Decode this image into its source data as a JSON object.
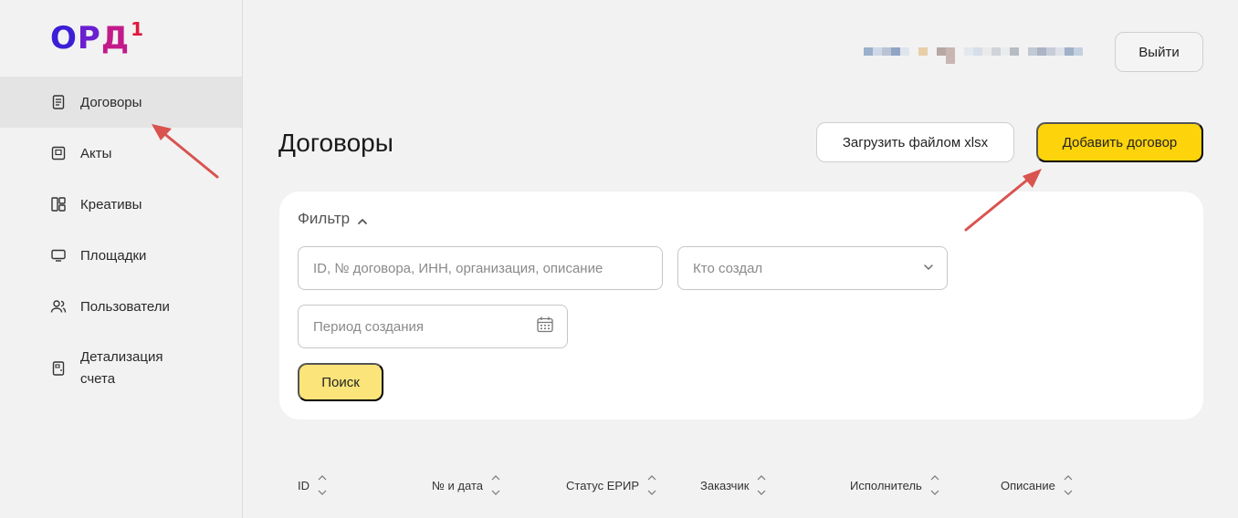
{
  "logo": {
    "part1": "О",
    "part2": "Р",
    "part3": "Д",
    "sup": "1"
  },
  "sidebar": {
    "items": [
      {
        "label": "Договоры",
        "icon": "document-icon",
        "active": true
      },
      {
        "label": "Акты",
        "icon": "act-icon"
      },
      {
        "label": "Креативы",
        "icon": "creatives-icon"
      },
      {
        "label": "Площадки",
        "icon": "monitor-icon"
      },
      {
        "label": "Пользователи",
        "icon": "users-icon"
      },
      {
        "label": "Детализация счета",
        "icon": "invoice-icon"
      }
    ]
  },
  "header": {
    "logout_label": "Выйти"
  },
  "main": {
    "title": "Договоры",
    "upload_label": "Загрузить файлом xlsx",
    "add_label": "Добавить договор"
  },
  "filter": {
    "title": "Фильтр",
    "search_placeholder": "ID, № договора, ИНН, организация, описание",
    "creator_placeholder": "Кто создал",
    "period_placeholder": "Период создания",
    "search_button": "Поиск"
  },
  "table": {
    "columns": [
      "ID",
      "№ и дата",
      "Статус ЕРИР",
      "Заказчик",
      "Исполнитель",
      "Описание"
    ]
  },
  "colors": {
    "accent": "#fdd30c",
    "accent_light": "#fbe57a",
    "arrow": "#d9534f"
  }
}
